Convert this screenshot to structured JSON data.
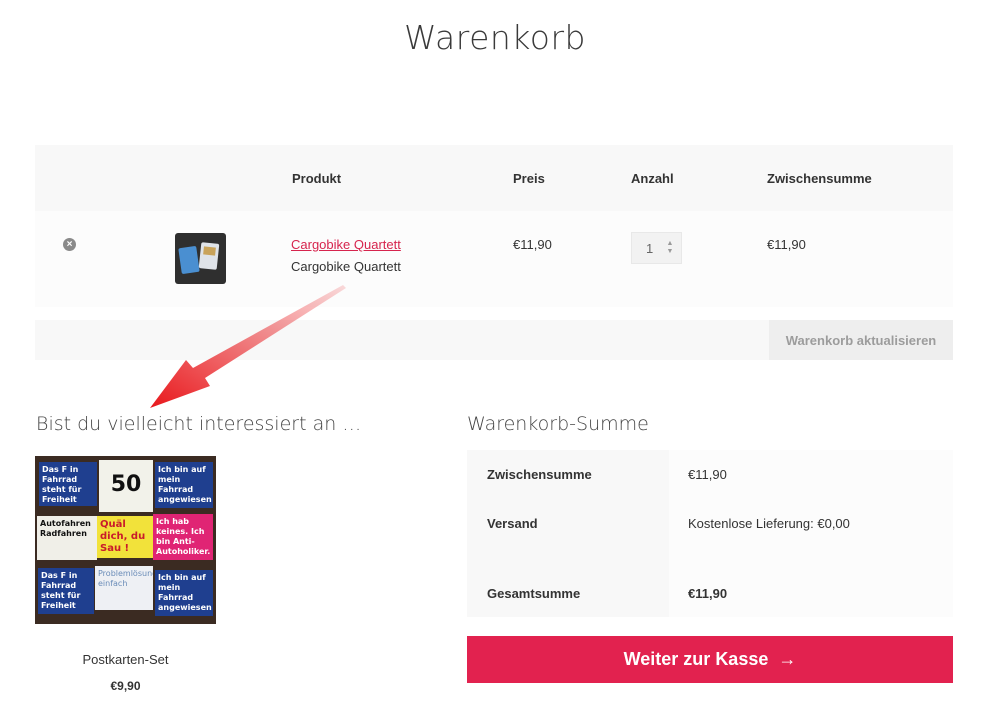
{
  "page": {
    "title": "Warenkorb"
  },
  "cart": {
    "headers": {
      "product": "Produkt",
      "price": "Preis",
      "quantity": "Anzahl",
      "subtotal": "Zwischensumme"
    },
    "items": [
      {
        "name": "Cargobike Quartett",
        "variant": "Cargobike Quartett",
        "price": "€11,90",
        "quantity": "1",
        "subtotal": "€11,90",
        "remove_icon": "×"
      }
    ],
    "update_label": "Warenkorb aktualisieren"
  },
  "cross_sells": {
    "heading": "Bist du vielleicht interessiert an …",
    "product": {
      "title": "Postkarten-Set",
      "price": "€9,90",
      "cards": [
        "Das F in Fahrrad steht für Freiheit",
        "50",
        "Ich bin auf mein Fahrrad angewiesen",
        "Autofahren Radfahren",
        "Quäl dich, du Sau !",
        "Ich hab keines. Ich bin Anti-Autoholiker.",
        "Das F in Fahrrad steht für Freiheit",
        "Problemlösungen einfach",
        "Ich bin auf mein Fahrrad angewiesen"
      ]
    }
  },
  "totals": {
    "heading": "Warenkorb-Summe",
    "rows": [
      {
        "label": "Zwischensumme",
        "value": "€11,90"
      },
      {
        "label": "Versand",
        "value": "Kostenlose Lieferung: €0,00"
      },
      {
        "label": "Gesamtsumme",
        "value": "€11,90"
      }
    ],
    "checkout_label": "Weiter zur Kasse",
    "checkout_icon": "→"
  },
  "colors": {
    "accent": "#e2224f",
    "link": "#d6244d",
    "annotation_arrow": "#e8181c"
  }
}
